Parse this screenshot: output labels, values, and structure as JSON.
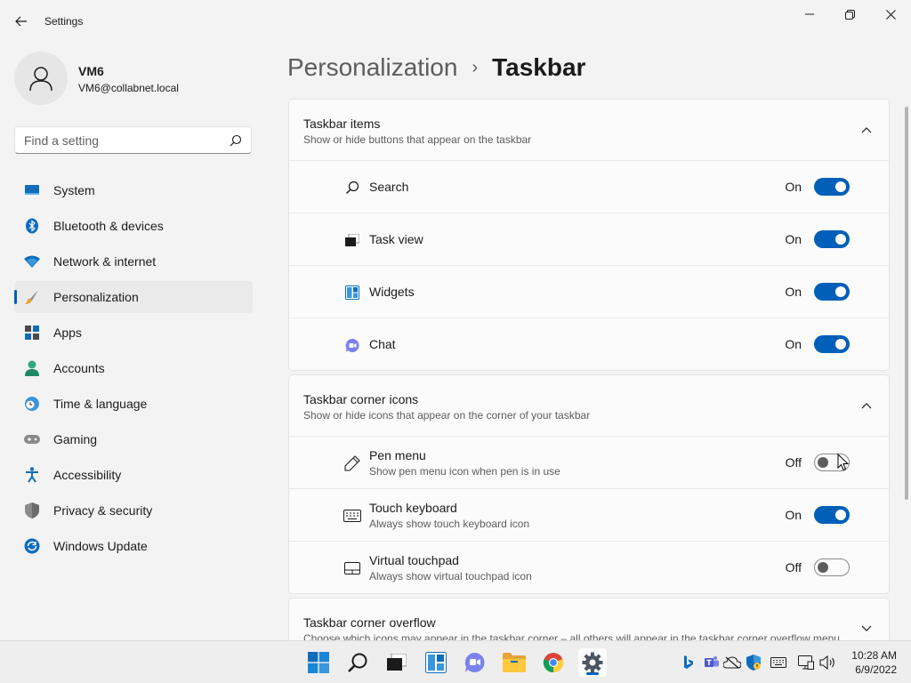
{
  "window": {
    "title": "Settings"
  },
  "profile": {
    "name": "VM6",
    "email": "VM6@collabnet.local"
  },
  "search": {
    "placeholder": "Find a setting"
  },
  "nav": {
    "items": [
      {
        "label": "System",
        "icon": "system-icon"
      },
      {
        "label": "Bluetooth & devices",
        "icon": "bluetooth-icon"
      },
      {
        "label": "Network & internet",
        "icon": "wifi-icon"
      },
      {
        "label": "Personalization",
        "icon": "brush-icon",
        "active": true
      },
      {
        "label": "Apps",
        "icon": "apps-icon"
      },
      {
        "label": "Accounts",
        "icon": "accounts-icon"
      },
      {
        "label": "Time & language",
        "icon": "time-language-icon"
      },
      {
        "label": "Gaming",
        "icon": "gaming-icon"
      },
      {
        "label": "Accessibility",
        "icon": "accessibility-icon"
      },
      {
        "label": "Privacy & security",
        "icon": "shield-icon"
      },
      {
        "label": "Windows Update",
        "icon": "windows-update-icon"
      }
    ]
  },
  "breadcrumb": {
    "parent": "Personalization",
    "separator": "›",
    "current": "Taskbar"
  },
  "sections": {
    "taskbar_items": {
      "title": "Taskbar items",
      "subtitle": "Show or hide buttons that appear on the taskbar",
      "rows": [
        {
          "label": "Search",
          "state": "On",
          "icon": "search-icon"
        },
        {
          "label": "Task view",
          "state": "On",
          "icon": "task-view-icon"
        },
        {
          "label": "Widgets",
          "state": "On",
          "icon": "widgets-icon"
        },
        {
          "label": "Chat",
          "state": "On",
          "icon": "chat-icon"
        }
      ]
    },
    "corner_icons": {
      "title": "Taskbar corner icons",
      "subtitle": "Show or hide icons that appear on the corner of your taskbar",
      "rows": [
        {
          "label": "Pen menu",
          "desc": "Show pen menu icon when pen is in use",
          "state": "Off",
          "icon": "pen-icon"
        },
        {
          "label": "Touch keyboard",
          "desc": "Always show touch keyboard icon",
          "state": "On",
          "icon": "keyboard-icon"
        },
        {
          "label": "Virtual touchpad",
          "desc": "Always show virtual touchpad icon",
          "state": "Off",
          "icon": "touchpad-icon"
        }
      ]
    },
    "corner_overflow": {
      "title": "Taskbar corner overflow",
      "subtitle": "Choose which icons may appear in the taskbar corner – all others will appear in the taskbar corner overflow menu"
    }
  },
  "taskbar": {
    "apps": [
      "start-icon",
      "search-icon",
      "task-view-icon",
      "widgets-icon",
      "chat-icon",
      "file-explorer-icon",
      "chrome-icon",
      "settings-icon"
    ],
    "active_app": "settings-icon",
    "clock": {
      "time": "10:28 AM",
      "date": "6/9/2022"
    }
  },
  "colors": {
    "accent": "#005fb8",
    "background": "#f3f3f3",
    "card": "#fbfbfb"
  }
}
